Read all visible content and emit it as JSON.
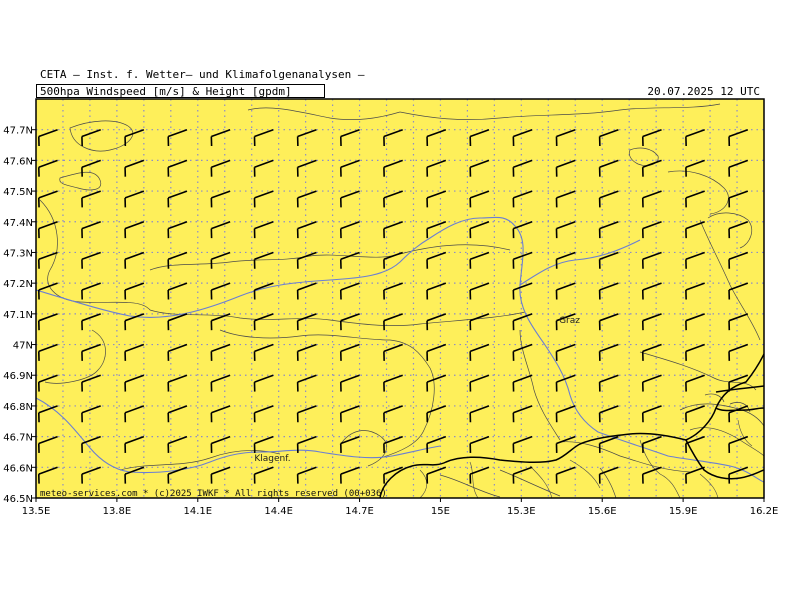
{
  "header": {
    "title": "CETA — Inst. f. Wetter— und Klimafolgenanalysen —",
    "subtitle": "500hpa_Windspeed_[m/s]_&_Height_[gpdm]",
    "datetime": "20.07.2025 12 UTC"
  },
  "map": {
    "lon_range": [
      13.5,
      16.2
    ],
    "lat_range": [
      46.5,
      47.8
    ],
    "lon_ticks": [
      "13.5E",
      "13.8E",
      "14.1E",
      "14.4E",
      "14.7E",
      "15E",
      "15.3E",
      "15.6E",
      "15.9E",
      "16.2E"
    ],
    "lat_ticks": [
      "46.5N",
      "46.6N",
      "46.7N",
      "46.8N",
      "46.9N",
      "47N",
      "47.1N",
      "47.2N",
      "47.3N",
      "47.4N",
      "47.5N",
      "47.6N",
      "47.7N"
    ],
    "cities": [
      {
        "name": "Graz",
        "lon": 15.44,
        "lat": 47.07
      },
      {
        "name": "Klagenf.",
        "lon": 14.31,
        "lat": 46.62
      }
    ],
    "wind_barbs": {
      "spacing_lon": 0.16,
      "spacing_lat": 0.1,
      "speed_ms": 10,
      "direction_from_deg": 250
    },
    "footer": "meteo-services.com * (c)2025 IWKF * All rights reserved (00+036)",
    "colors": {
      "fill": "#FEEF5A",
      "grid": "#8C8CC8",
      "river": "#6A7ED4",
      "border": "#000000",
      "admin": "#4A4A4A",
      "barb": "#000000"
    }
  }
}
